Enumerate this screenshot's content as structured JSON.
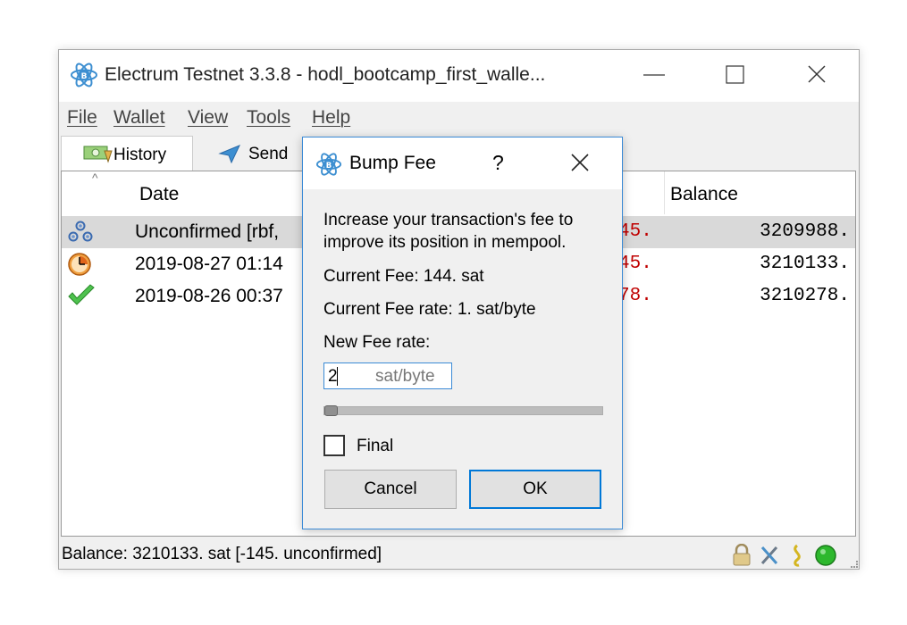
{
  "window": {
    "title": "Electrum Testnet 3.3.8  -  hodl_bootcamp_first_walle...",
    "controls": {
      "minimize": "—",
      "maximize": "☐",
      "close": "✕"
    }
  },
  "menu": [
    "File",
    "Wallet",
    "View",
    "Tools",
    "Help"
  ],
  "tabs": [
    {
      "label": "History",
      "icon": "history-icon"
    },
    {
      "label": "Send",
      "icon": "send-icon"
    }
  ],
  "history": {
    "sort_indicator": "^",
    "columns": {
      "date": "Date",
      "balance": "Balance"
    },
    "rows": [
      {
        "status_icon": "unconfirmed-gears-icon",
        "date": "Unconfirmed [rbf,",
        "amount": "45.",
        "balance": "3209988."
      },
      {
        "status_icon": "clock-icon",
        "date": "2019-08-27 01:14",
        "amount": "45.",
        "balance": "3210133."
      },
      {
        "status_icon": "checkmark-icon",
        "date": "2019-08-26 00:37",
        "amount": "78.",
        "balance": "3210278."
      }
    ]
  },
  "status": {
    "text": "Balance: 3210133. sat  [-145. unconfirmed]",
    "icons": [
      "lock-icon",
      "tools-icon",
      "seed-icon",
      "network-status-icon"
    ]
  },
  "dialog": {
    "title": "Bump Fee",
    "help": "?",
    "close": "✕",
    "description_line1": "Increase your transaction's fee to",
    "description_line2": "improve its position in mempool.",
    "current_fee": "Current Fee: 144. sat",
    "current_fee_rate": "Current Fee rate: 1. sat/byte",
    "new_fee_rate_label": "New Fee rate:",
    "fee_input_value": "2",
    "fee_input_unit": "sat/byte",
    "slider_position": 0,
    "final_checkbox_label": "Final",
    "final_checked": false,
    "cancel_label": "Cancel",
    "ok_label": "OK"
  },
  "colors": {
    "accent": "#0078d7",
    "negative_amount": "#c00000",
    "status_green": "#2db82d"
  }
}
